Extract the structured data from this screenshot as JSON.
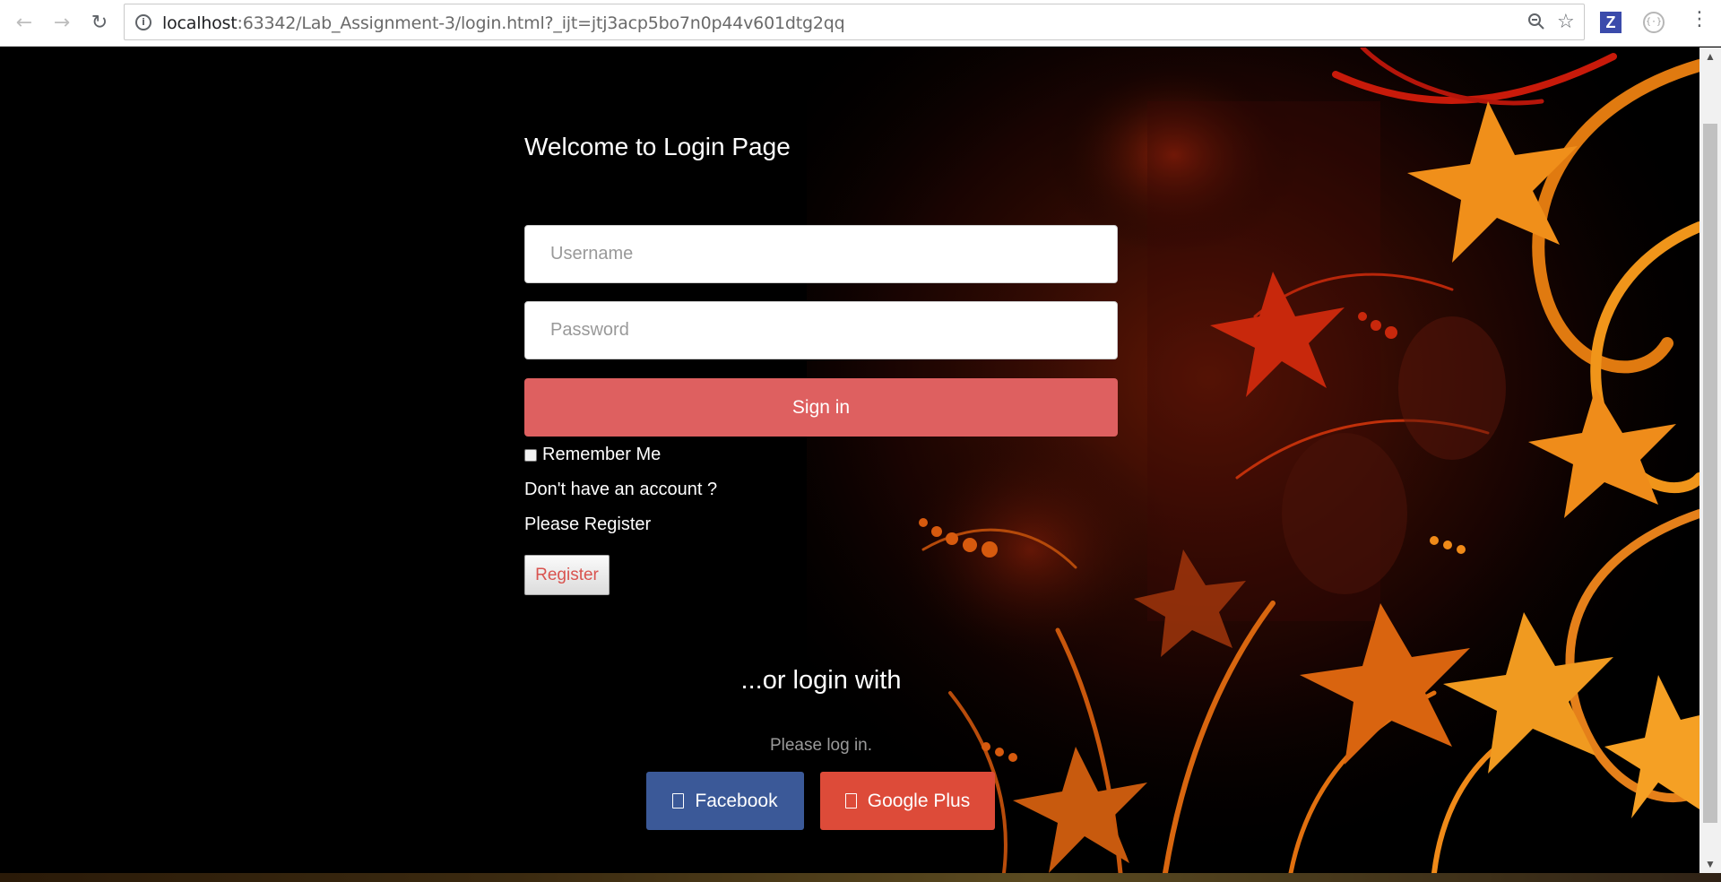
{
  "browser": {
    "url_host": "localhost",
    "url_rest": ":63342/Lab_Assignment-3/login.html?_ijt=jtj3acp5bo7n0p44v601dtg2qq",
    "icons": [
      "back-arrow-icon",
      "forward-arrow-icon",
      "reload-icon",
      "info-icon",
      "zoom-out-icon",
      "star-icon",
      "extension-z-icon",
      "extension-code-icon",
      "menu-dots-icon"
    ],
    "extension_z_label": "Z"
  },
  "login": {
    "title": "Welcome to Login Page",
    "username_placeholder": "Username",
    "password_placeholder": "Password",
    "signin_label": "Sign in",
    "remember_label": "Remember Me",
    "no_account_text": "Don't have an account ?",
    "please_register_text": "Please Register",
    "register_label": "Register",
    "or_login_text": "...or login with",
    "please_login_text": "Please log in.",
    "facebook_label": "Facebook",
    "google_label": "Google Plus"
  },
  "colors": {
    "signin_bg": "#de6060",
    "facebook_bg": "#3b5998",
    "google_bg": "#dd4b39",
    "register_text": "#d9534f"
  }
}
